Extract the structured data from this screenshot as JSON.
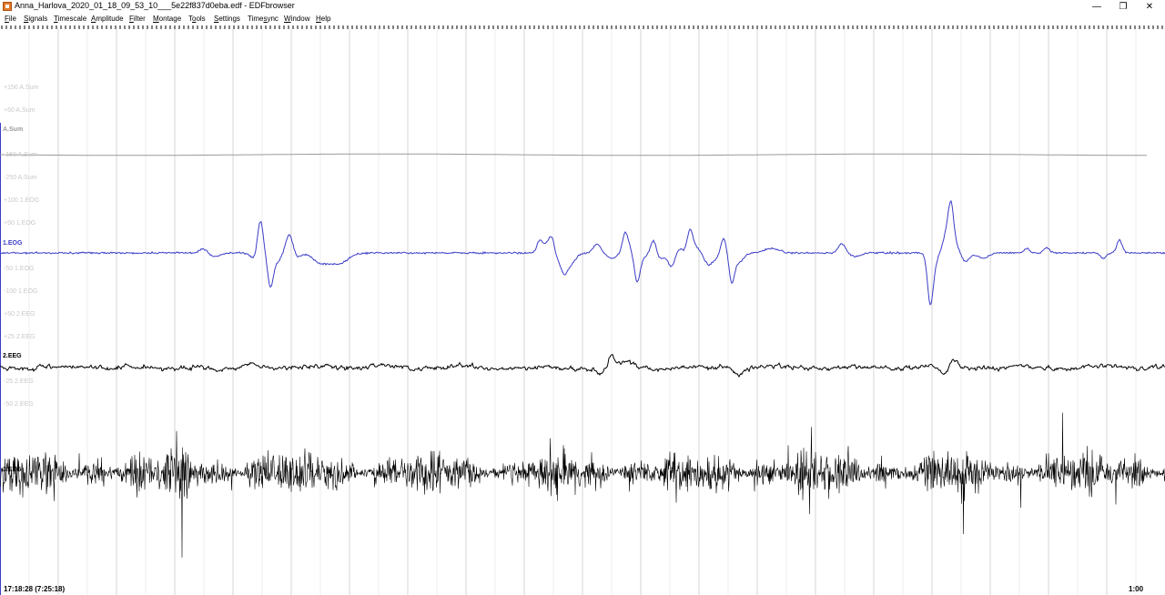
{
  "window": {
    "title": "Anna_Harlova_2020_01_18_09_53_10___5e22f837d0eba.edf - EDFbrowser",
    "app_icon": "edfbrowser-icon",
    "minimize": "—",
    "restore": "❐",
    "close": "✕"
  },
  "menu": [
    {
      "label": "File",
      "u": "F",
      "rest": "ile"
    },
    {
      "label": "Signals",
      "u": "S",
      "rest": "ignals"
    },
    {
      "label": "Timescale",
      "u": "T",
      "rest": "imescale"
    },
    {
      "label": "Amplitude",
      "u": "A",
      "rest": "mplitude"
    },
    {
      "label": "Filter",
      "u": "F",
      "rest": "ilter"
    },
    {
      "label": "Montage",
      "u": "M",
      "rest": "ontage"
    },
    {
      "label": "Tools",
      "pre": "T",
      "u": "o",
      "rest": "ols"
    },
    {
      "label": "Settings",
      "u": "S",
      "rest": "ettings"
    },
    {
      "label": "Timesync",
      "pre": "Time",
      "u": "s",
      "rest": "ync"
    },
    {
      "label": "Window",
      "u": "W",
      "rest": "indow"
    },
    {
      "label": "Help",
      "u": "H",
      "rest": "elp"
    }
  ],
  "scale_labels": [
    "+150 A.Sum",
    "+50 A.Sum",
    "-150 A.Sum",
    "-250 A.Sum",
    "+100 1.EOG",
    "+50 1.EOG",
    "-50 1.EOG",
    "-100 1.EOG",
    "+50 2.EEG",
    "+25 2.EEG",
    "-25 2.EEG",
    "-50 2.EEG"
  ],
  "signals": [
    {
      "label": "A.Sum",
      "color": "#9a9a9a"
    },
    {
      "label": "1.EOG",
      "color": "#3c3cc8"
    },
    {
      "label": "2.EEG",
      "color": "#000000"
    },
    {
      "label": "3.EEG",
      "color": "#000000"
    }
  ],
  "status": {
    "time": "17:18:28 (7:25:18)",
    "page": "1:00"
  },
  "colors": {
    "grid": "#d6d6d6",
    "eog": "#3c3cc8",
    "eeg": "#000000",
    "sum": "#9a9a9a"
  }
}
